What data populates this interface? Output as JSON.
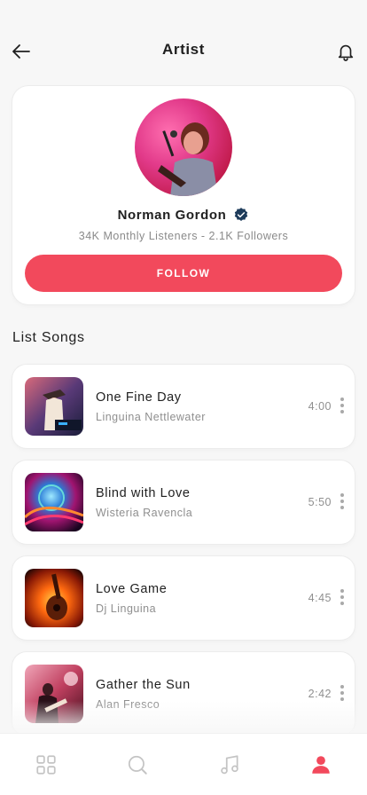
{
  "header": {
    "title": "Artist",
    "back_icon": "arrow-left-icon",
    "notification_icon": "bell-icon"
  },
  "artist": {
    "name": "Norman Gordon",
    "verified_icon": "verified-badge-icon",
    "stats": "34K Monthly Listeners - 2.1K Followers",
    "follow_label": "FOLLOW"
  },
  "songs_section": {
    "title": "List Songs",
    "songs": [
      {
        "title": "One Fine Day",
        "artist": "Linguina Nettlewater",
        "duration": "4:00"
      },
      {
        "title": "Blind with Love",
        "artist": "Wisteria Ravencla",
        "duration": "5:50"
      },
      {
        "title": "Love Game",
        "artist": "Dj Linguina",
        "duration": "4:45"
      },
      {
        "title": "Gather the Sun",
        "artist": "Alan Fresco",
        "duration": "2:42"
      }
    ]
  },
  "bottom_nav": {
    "items": [
      {
        "icon": "grid-icon",
        "active": false
      },
      {
        "icon": "search-icon",
        "active": false
      },
      {
        "icon": "music-note-icon",
        "active": false
      },
      {
        "icon": "profile-icon",
        "active": true
      }
    ]
  },
  "colors": {
    "accent": "#f2495c",
    "background": "#f7f7f7",
    "card": "#ffffff",
    "verified": "#1d3b5a",
    "icon_inactive": "#c4c4c4"
  }
}
